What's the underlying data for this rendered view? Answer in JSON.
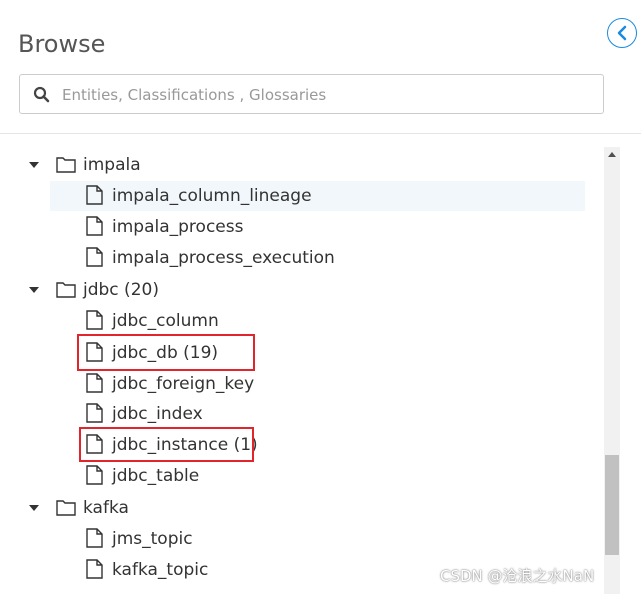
{
  "panel": {
    "title": "Browse"
  },
  "search": {
    "placeholder": "Entities, Classifications , Glossaries",
    "value": ""
  },
  "tree": {
    "groups": [
      {
        "label": "impala",
        "children": [
          "impala_column_lineage",
          "impala_process",
          "impala_process_execution"
        ]
      },
      {
        "label": "jdbc (20)",
        "children": [
          "jdbc_column",
          "jdbc_db (19)",
          "jdbc_foreign_key",
          "jdbc_index",
          "jdbc_instance (1)",
          "jdbc_table"
        ]
      },
      {
        "label": "kafka",
        "children": [
          "jms_topic",
          "kafka_topic"
        ]
      }
    ]
  },
  "watermark": "CSDN @沧浪之水NaN",
  "colors": {
    "accent": "#1a8be0",
    "highlight": "#e0262c",
    "selected_row": "#f2f7fb"
  }
}
